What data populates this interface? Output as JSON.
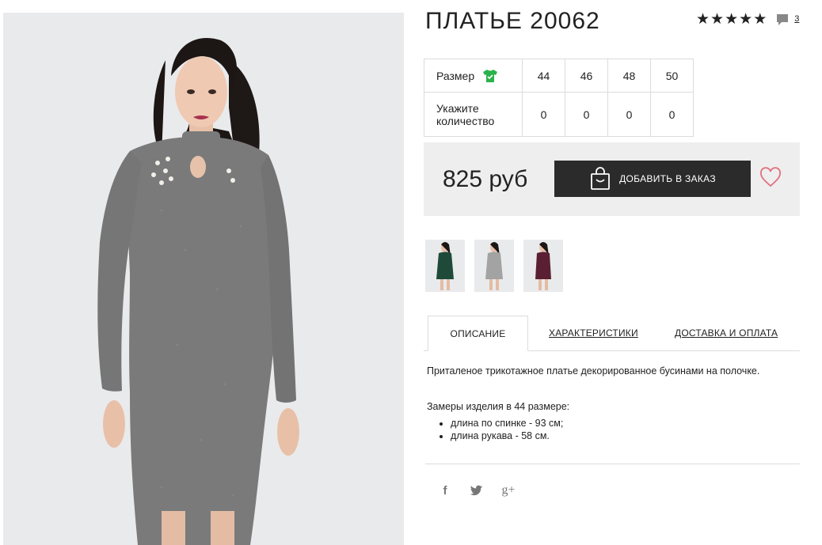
{
  "product": {
    "title": "ПЛАТЬЕ 20062",
    "rating_stars": 5,
    "review_count": "3"
  },
  "size_table": {
    "size_label": "Размер",
    "sizes": [
      "44",
      "46",
      "48",
      "50"
    ],
    "quantity_label_line1": "Укажите",
    "quantity_label_line2": "количество",
    "quantities": [
      "0",
      "0",
      "0",
      "0"
    ]
  },
  "purchase": {
    "price": "825 руб",
    "add_button_label": "ДОБАВИТЬ В ЗАКАЗ"
  },
  "thumbnails": [
    {
      "color_name": "green",
      "dress_color": "#1f4a3a"
    },
    {
      "color_name": "grey",
      "dress_color": "#9a9a9a"
    },
    {
      "color_name": "burgundy",
      "dress_color": "#5a1f33"
    }
  ],
  "tabs": [
    {
      "label": "ОПИСАНИЕ",
      "active": true
    },
    {
      "label": "ХАРАКТЕРИСТИКИ",
      "active": false
    },
    {
      "label": "ДОСТАВКА И ОПЛАТА",
      "active": false
    }
  ],
  "description": {
    "text": "Приталеное трикотажное платье декорированное бусинами на полочке.",
    "measurements_title": "Замеры изделия в 44 размере:",
    "measurements": [
      "длина по спинке - 93 см;",
      "длина рукава - 58 см."
    ]
  },
  "social": {
    "facebook": "f",
    "twitter": "twitter-icon",
    "google_plus": "g+"
  },
  "colors": {
    "accent_icon": "#2bb24c",
    "button_bg": "#2b2b2b",
    "heart": "#e0707f",
    "panel_bg": "#eeeeee"
  }
}
